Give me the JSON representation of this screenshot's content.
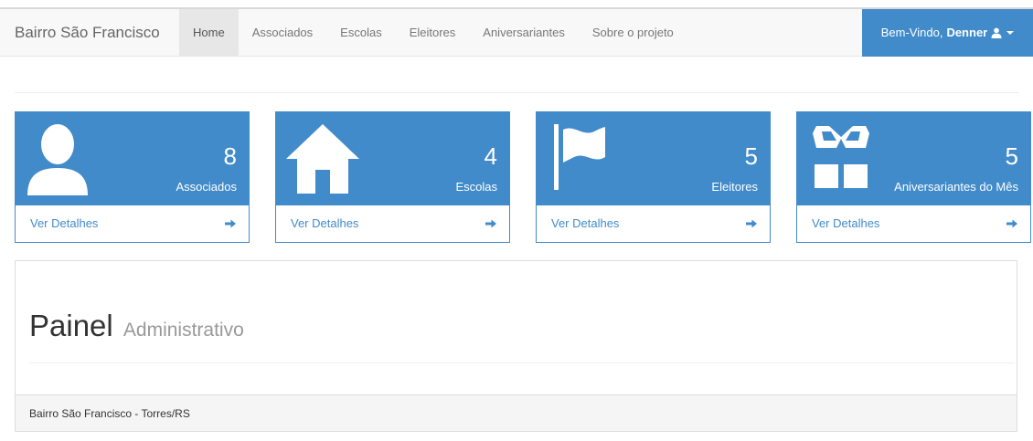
{
  "navbar": {
    "brand": "Bairro São Francisco",
    "items": [
      {
        "label": "Home",
        "active": true
      },
      {
        "label": "Associados",
        "active": false
      },
      {
        "label": "Escolas",
        "active": false
      },
      {
        "label": "Eleitores",
        "active": false
      },
      {
        "label": "Aniversariantes",
        "active": false
      },
      {
        "label": "Sobre o projeto",
        "active": false
      }
    ],
    "user": {
      "greeting": "Bem-Vindo,",
      "name": "Denner",
      "icon": "user-icon",
      "dropdown_icon": "caret-down-icon"
    }
  },
  "cards": [
    {
      "icon": "user-silhouette-icon",
      "count": "8",
      "label": "Associados",
      "details": "Ver Detalhes"
    },
    {
      "icon": "home-icon",
      "count": "4",
      "label": "Escolas",
      "details": "Ver Detalhes"
    },
    {
      "icon": "flag-icon",
      "count": "5",
      "label": "Eleitores",
      "details": "Ver Detalhes"
    },
    {
      "icon": "gift-icon",
      "count": "5",
      "label": "Aniversariantes do Mês",
      "details": "Ver Detalhes"
    }
  ],
  "panel": {
    "title": "Painel",
    "subtitle": "Administrativo",
    "footer": "Bairro São Francisco - Torres/RS"
  },
  "colors": {
    "primary": "#428bca",
    "navbar_bg": "#f8f8f8",
    "active_nav_bg": "#e7e7e7",
    "footer_bg": "#f5f5f5"
  }
}
